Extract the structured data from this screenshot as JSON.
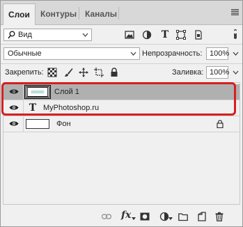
{
  "tabs": [
    {
      "label": "Слои",
      "active": true
    },
    {
      "label": "Контуры",
      "active": false
    },
    {
      "label": "Каналы",
      "active": false
    }
  ],
  "filter": {
    "selected": "Вид"
  },
  "blend": {
    "mode": "Обычные",
    "opacity_label": "Непрозрачность:",
    "opacity_value": "100%",
    "lock_label": "Закрепить:",
    "fill_label": "Заливка:",
    "fill_value": "100%"
  },
  "layers": [
    {
      "name": "Слой 1",
      "type": "image",
      "selected": true,
      "visible": true
    },
    {
      "name": "MyPhotoshop.ru",
      "type": "text",
      "selected": false,
      "visible": true
    },
    {
      "name": "Фон",
      "type": "background",
      "selected": false,
      "visible": true,
      "locked": true
    }
  ],
  "filter_type_glyph": "T",
  "text_layer_glyph": "T",
  "bottom_fx": "fx",
  "colors": {
    "highlight": "#d61f1f",
    "selected_row": "#b0b0b0"
  }
}
